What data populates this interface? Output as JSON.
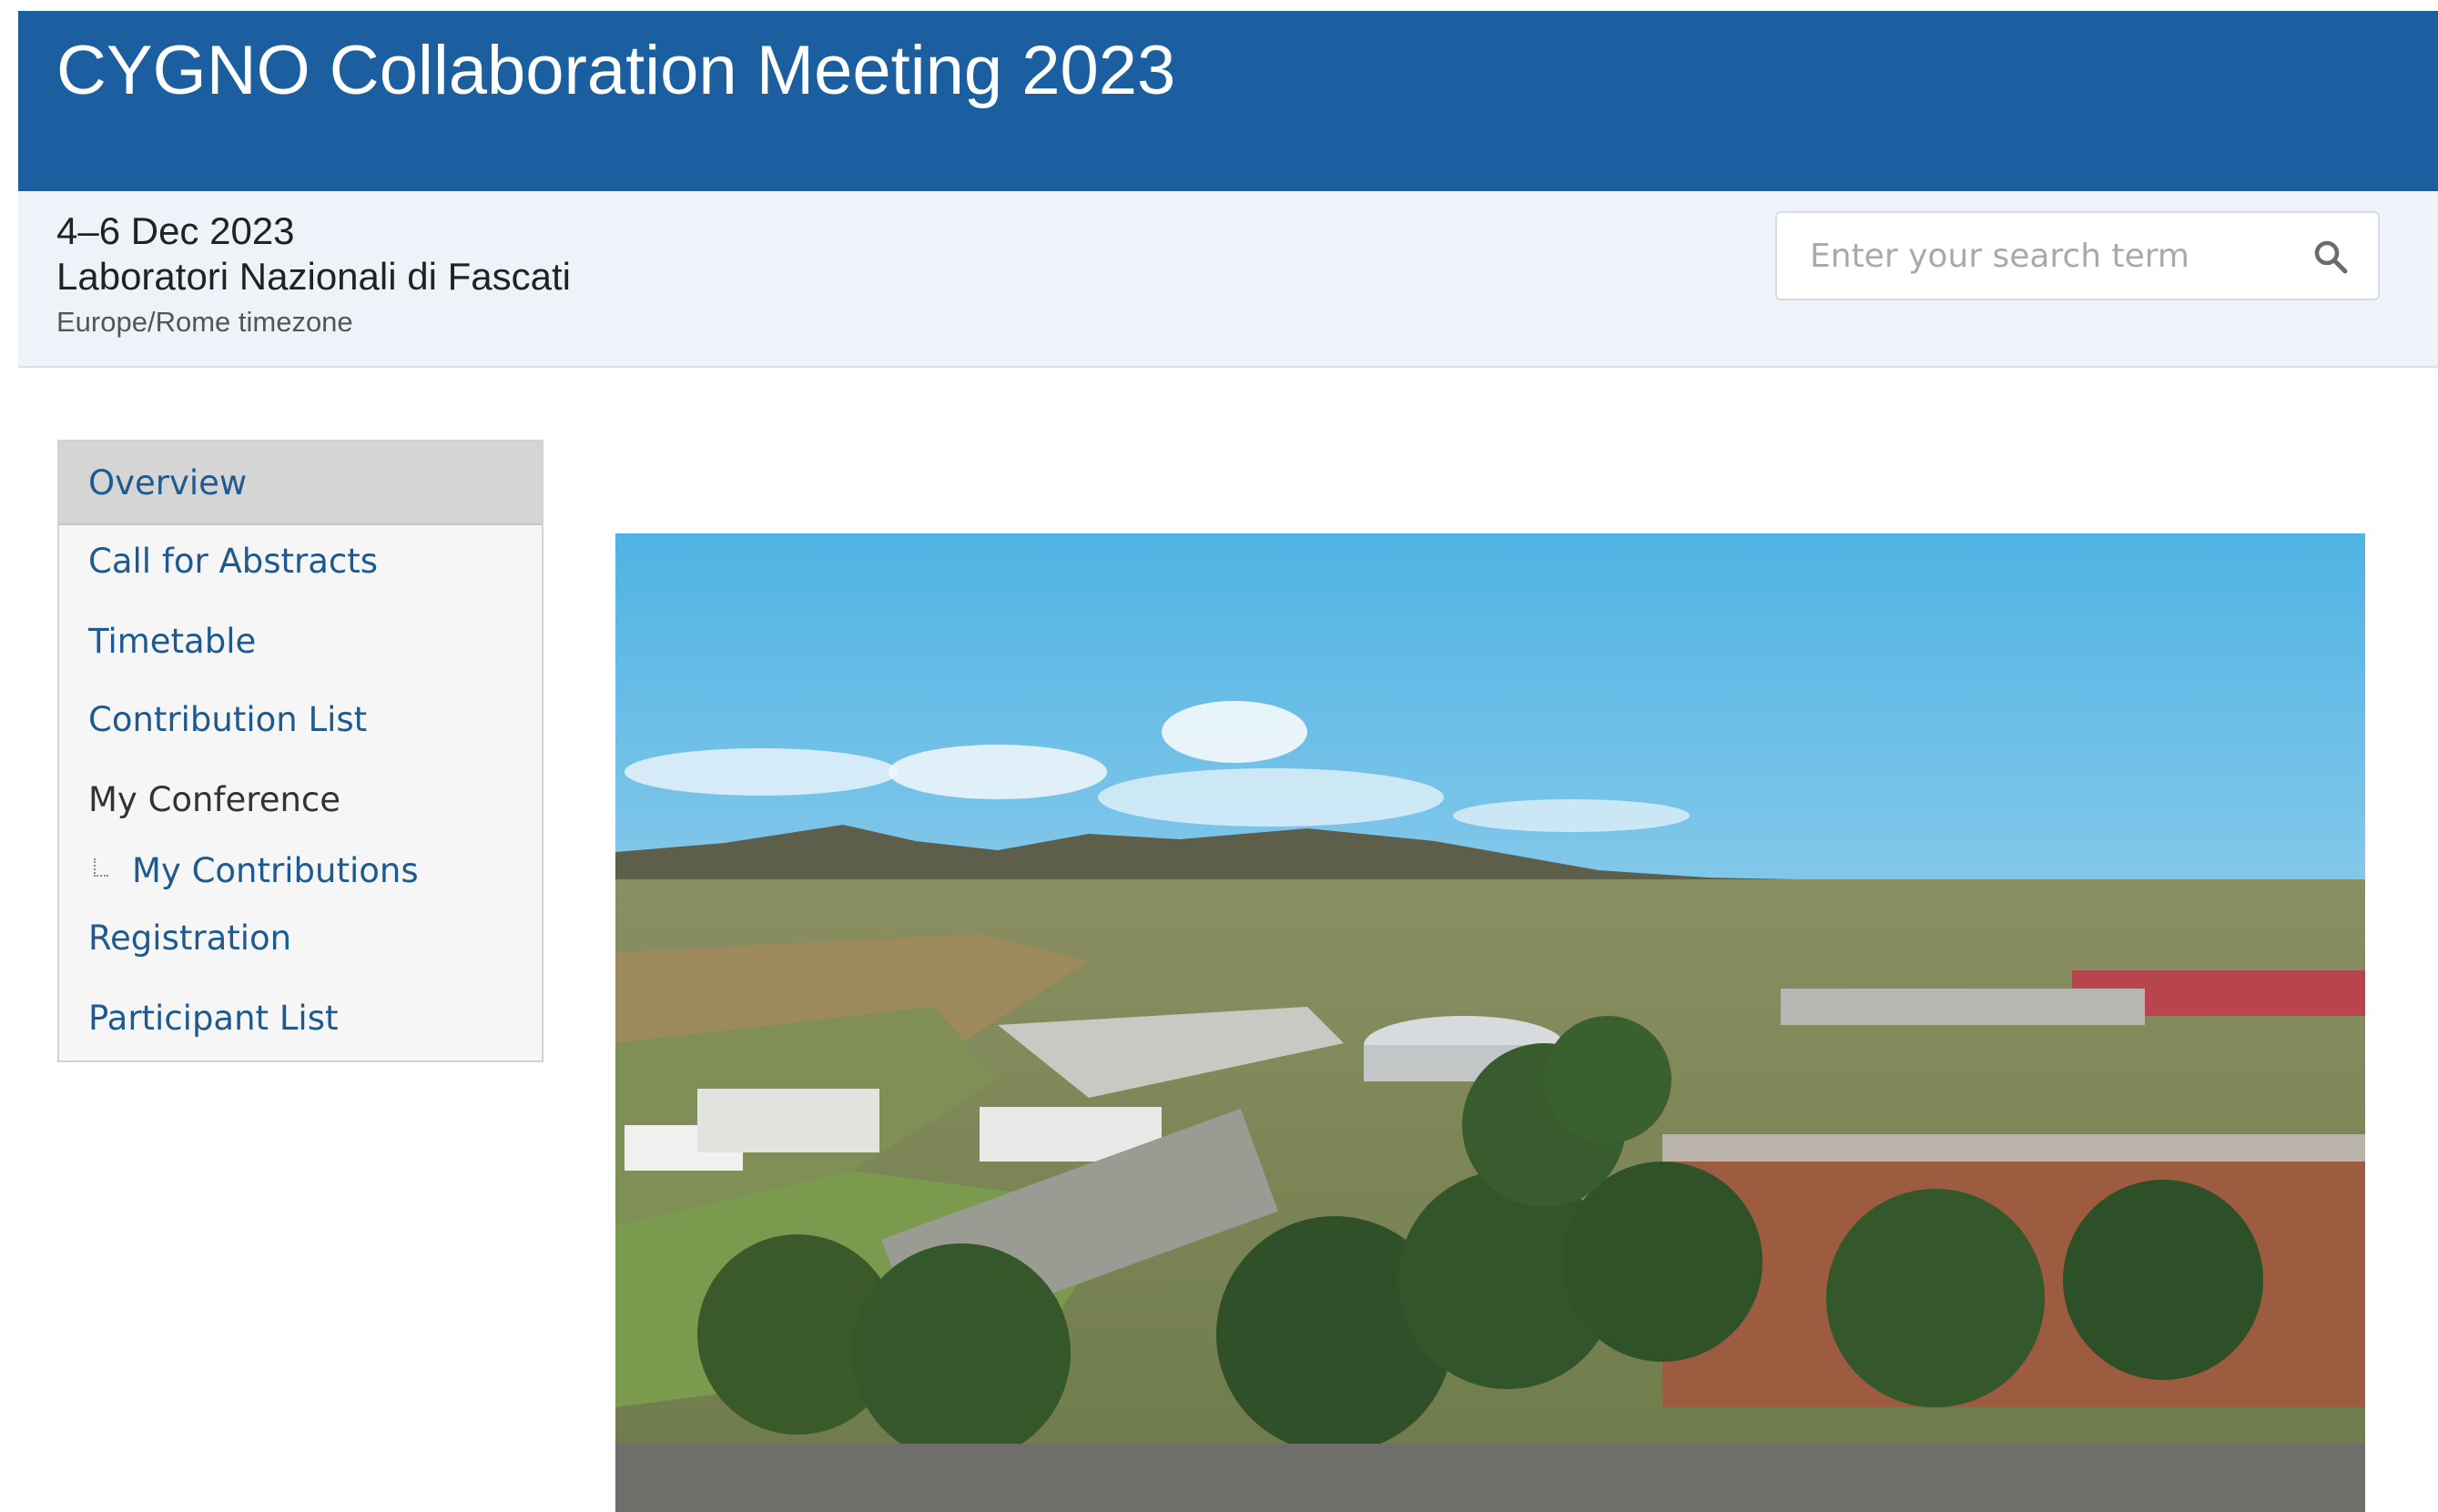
{
  "header": {
    "title": "CYGNO Collaboration Meeting 2023"
  },
  "event": {
    "dates": "4–6 Dec 2023",
    "venue": "Laboratori Nazionali di Fascati",
    "timezone": "Europe/Rome timezone"
  },
  "search": {
    "placeholder": "Enter your search term",
    "icon": "search-icon"
  },
  "menu": {
    "items": [
      {
        "label": "Overview",
        "active": true
      },
      {
        "label": "Call for Abstracts"
      },
      {
        "label": "Timetable"
      },
      {
        "label": "Contribution List"
      },
      {
        "label": "My Conference"
      },
      {
        "label": "My Contributions"
      },
      {
        "label": "Registration"
      },
      {
        "label": "Participant List"
      }
    ]
  },
  "colors": {
    "banner": "#1b5fa0",
    "subheader": "#eef3fa",
    "link": "#1e5a8f",
    "menu_active": "#d5d5d5"
  }
}
